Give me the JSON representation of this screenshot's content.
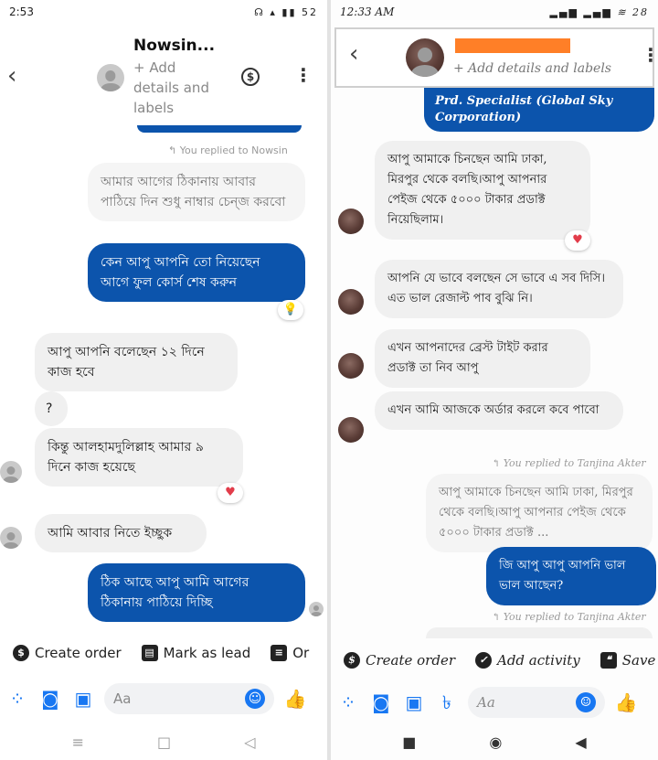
{
  "left": {
    "status": {
      "time": "2:53",
      "icons": "☊ ▴ ▮▮ 52"
    },
    "header": {
      "name": "Nowsin...",
      "subtitle_lines": [
        "+ Add",
        "details and",
        "labels"
      ]
    },
    "replied": "You replied to Nowsin",
    "messages": [
      {
        "text": "আমার আগের ঠিকানায় আবার পাঠিয়ে দিন শুধু নাম্বার চেন্জ করবো"
      },
      {
        "text": "কেন আপু আপনি তো নিয়েছেন আগে ফুল কোর্স শেষ করুন"
      },
      {
        "text": "আপু আপনি বলেছেন ১২ দিনে কাজ হবে"
      },
      {
        "text": "?"
      },
      {
        "text": "কিন্তু আলহামদুলিল্লাহ আমার ৯ দিনে কাজ হয়েছে"
      },
      {
        "text": "আমি আবার নিতে ইচ্ছুক"
      },
      {
        "text": "ঠিক আছে আপু আমি আগের ঠিকানায় পাঠিয়ে দিচ্ছি"
      }
    ],
    "chips": [
      "Create order",
      "Mark as lead",
      "Or"
    ],
    "composer_placeholder": "Aa",
    "nav": [
      "≡",
      "□",
      "◁"
    ]
  },
  "right": {
    "status": {
      "time": "12:33 AM",
      "icons": "▂▄▆ ▂▄▆ ≋ 28"
    },
    "header": {
      "subtitle": "+ Add details and labels"
    },
    "top_fragment": "Prd. Specialist (Global Sky Corporation)",
    "messages": [
      {
        "text": "আপু আমাকে চিনছেন আমি ঢাকা, মিরপুর থেকে বলছি।আপু আপনার পেইজ থেকে ৫০০০ টাকার প্রডাক্ট নিয়েছিলাম।"
      },
      {
        "text": "আপনি যে ভাবে বলছেন সে ভাবে এ সব দিসি। এত ভাল রেজাল্ট পাব বুঝি নি।"
      },
      {
        "text": "এখন আপনাদের ব্রেস্ট টাইট করার প্রডাক্ট তা নিব আপু"
      },
      {
        "text": "এখন আমি আজকে অর্ডার করলে কবে পাবো"
      },
      {
        "text": "আপু আমাকে চিনছেন আমি ঢাকা, মিরপুর থেকে বলছি।আপু আপনার পেইজ থেকে ৫০০০ টাকার প্রডাক্ট ..."
      },
      {
        "text": "জি আপু আপু আপনি ভাল ভাল আছেন?"
      }
    ],
    "replied_1": "You replied to Tanjina Akter",
    "replied_2": "You replied to Tanjina Akter",
    "chips": [
      "Create order",
      "Add activity",
      "Save"
    ],
    "composer_placeholder": "Aa",
    "nav": [
      "■",
      "◉",
      "◀"
    ]
  },
  "colors": {
    "sent_bubble": "#0c54ac",
    "received_bubble": "#f0f0f0",
    "accent": "#1877f2",
    "redaction": "#ff7f27"
  }
}
